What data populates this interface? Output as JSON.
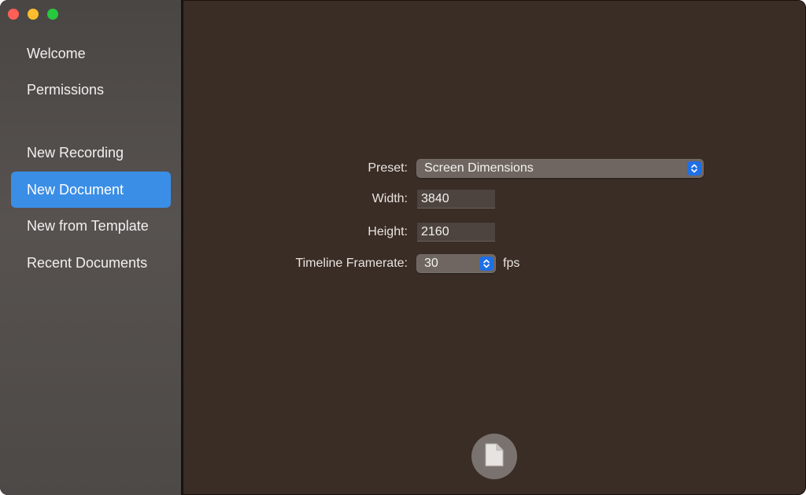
{
  "sidebar": {
    "items": [
      {
        "label": "Welcome"
      },
      {
        "label": "Permissions"
      },
      {
        "label": "New Recording"
      },
      {
        "label": "New Document"
      },
      {
        "label": "New from Template"
      },
      {
        "label": "Recent Documents"
      }
    ],
    "selected": "New Document"
  },
  "form": {
    "preset_label": "Preset:",
    "preset_value": "Screen Dimensions",
    "width_label": "Width:",
    "width_value": "3840",
    "height_label": "Height:",
    "height_value": "2160",
    "framerate_label": "Timeline Framerate:",
    "framerate_value": "30",
    "framerate_unit": "fps"
  },
  "footer": {
    "create_icon": "document-icon"
  },
  "colors": {
    "accent": "#3b8ee6",
    "stepper": "#1f6fe5",
    "main_bg": "#3a2d26"
  }
}
